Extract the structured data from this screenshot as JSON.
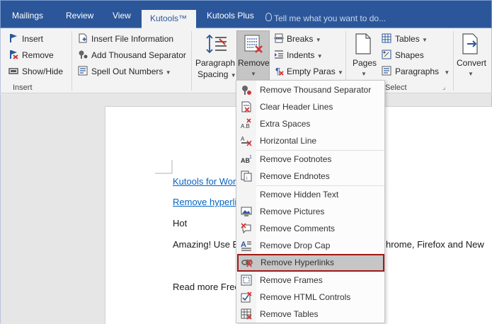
{
  "tabs": [
    {
      "label": "Mailings"
    },
    {
      "label": "Review"
    },
    {
      "label": "View"
    },
    {
      "label": "Kutools™"
    },
    {
      "label": "Kutools Plus"
    }
  ],
  "tell_me": "Tell me what you want to do...",
  "insert_group": {
    "items": [
      "Insert",
      "Remove",
      "Show/Hide"
    ],
    "label": "Insert"
  },
  "info_group": {
    "items": [
      "Insert File Information",
      "Add Thousand Separator",
      "Spell Out Numbers"
    ]
  },
  "paragraph_spacing": {
    "line1": "Paragraph",
    "line2": "Spacing"
  },
  "remove_button": "Remove",
  "breaks_group": {
    "items": [
      "Breaks",
      "Indents",
      "Empty Paras"
    ]
  },
  "pages_button": "Pages",
  "select_group": {
    "items": [
      "Tables",
      "Shapes",
      "Paragraphs"
    ],
    "label": "Select"
  },
  "convert_button": "Convert",
  "document": {
    "link1": "Kutools for Wor",
    "link2": "Remove hyperli",
    "line3": "Hot",
    "line4a": "Amazing! Use E",
    "line4b": "hrome, Firefox and New",
    "line5": "Read more Free"
  },
  "menu": {
    "items": [
      {
        "label": "Remove Thousand Separator",
        "icon": "thousand-separator-icon"
      },
      {
        "label": "Clear Header Lines",
        "icon": "header-lines-icon"
      },
      {
        "label": "Extra Spaces",
        "icon": "extra-spaces-icon"
      },
      {
        "label": "Horizontal Line",
        "icon": "horizontal-line-icon"
      },
      {
        "label": "Remove Footnotes",
        "icon": "footnote-icon"
      },
      {
        "label": "Remove Endnotes",
        "icon": "endnote-icon"
      },
      {
        "label": "Remove Hidden Text",
        "icon": "hidden-text-icon"
      },
      {
        "label": "Remove Pictures",
        "icon": "picture-icon"
      },
      {
        "label": "Remove Comments",
        "icon": "comment-icon"
      },
      {
        "label": "Remove Drop Cap",
        "icon": "drop-cap-icon"
      },
      {
        "label": "Remove Hyperlinks",
        "icon": "hyperlink-icon"
      },
      {
        "label": "Remove Frames",
        "icon": "frame-icon"
      },
      {
        "label": "Remove HTML Controls",
        "icon": "html-controls-icon"
      },
      {
        "label": "Remove Tables",
        "icon": "table-icon"
      }
    ]
  },
  "colors": {
    "accent": "#2b579a",
    "highlight_border": "#a01818",
    "link": "#0563c1"
  }
}
